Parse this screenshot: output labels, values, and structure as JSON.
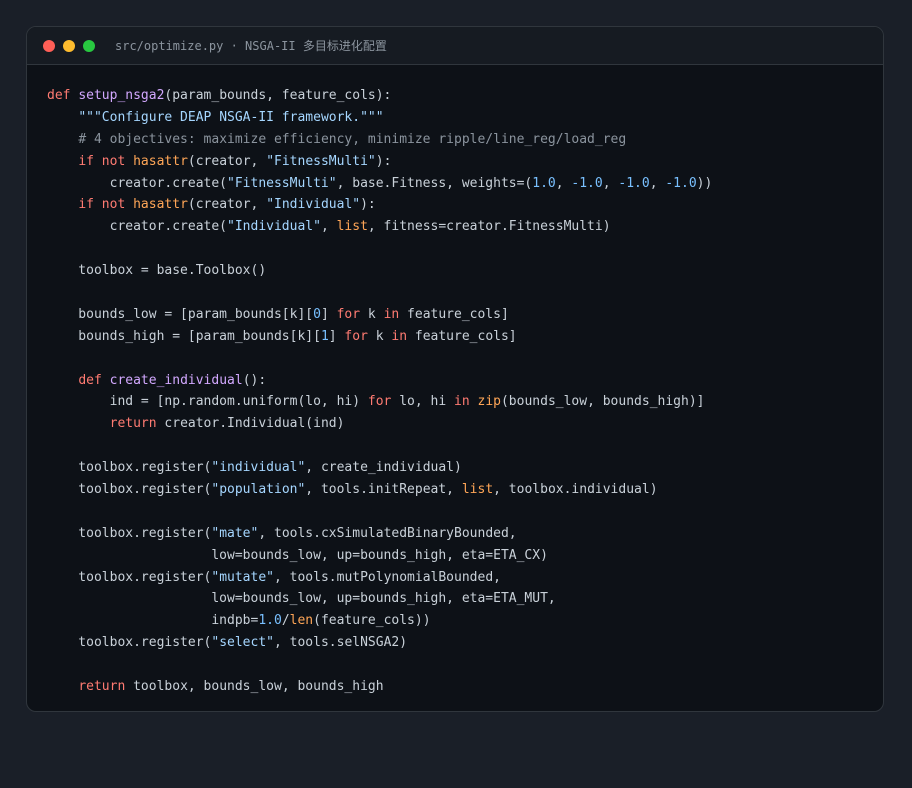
{
  "window": {
    "title": "src/optimize.py · NSGA-II 多目标进化配置"
  },
  "code": {
    "lines": [
      [
        {
          "t": "def",
          "c": "kw"
        },
        {
          "t": " "
        },
        {
          "t": "setup_nsga2",
          "c": "fn"
        },
        {
          "t": "(param_bounds, feature_cols):"
        }
      ],
      [
        {
          "t": "    "
        },
        {
          "t": "\"\"\"Configure DEAP NSGA-II framework.\"\"\"",
          "c": "doc"
        }
      ],
      [
        {
          "t": "    "
        },
        {
          "t": "# 4 objectives: maximize efficiency, minimize ripple/line_reg/load_reg",
          "c": "com"
        }
      ],
      [
        {
          "t": "    "
        },
        {
          "t": "if",
          "c": "kw"
        },
        {
          "t": " "
        },
        {
          "t": "not",
          "c": "kw"
        },
        {
          "t": " "
        },
        {
          "t": "hasattr",
          "c": "bi"
        },
        {
          "t": "(creator, "
        },
        {
          "t": "\"FitnessMulti\"",
          "c": "str"
        },
        {
          "t": "):"
        }
      ],
      [
        {
          "t": "        creator.create("
        },
        {
          "t": "\"FitnessMulti\"",
          "c": "str"
        },
        {
          "t": ", base.Fitness, weights=("
        },
        {
          "t": "1.0",
          "c": "num"
        },
        {
          "t": ", "
        },
        {
          "t": "-1.0",
          "c": "num"
        },
        {
          "t": ", "
        },
        {
          "t": "-1.0",
          "c": "num"
        },
        {
          "t": ", "
        },
        {
          "t": "-1.0",
          "c": "num"
        },
        {
          "t": "))"
        }
      ],
      [
        {
          "t": "    "
        },
        {
          "t": "if",
          "c": "kw"
        },
        {
          "t": " "
        },
        {
          "t": "not",
          "c": "kw"
        },
        {
          "t": " "
        },
        {
          "t": "hasattr",
          "c": "bi"
        },
        {
          "t": "(creator, "
        },
        {
          "t": "\"Individual\"",
          "c": "str"
        },
        {
          "t": "):"
        }
      ],
      [
        {
          "t": "        creator.create("
        },
        {
          "t": "\"Individual\"",
          "c": "str"
        },
        {
          "t": ", "
        },
        {
          "t": "list",
          "c": "bi"
        },
        {
          "t": ", fitness=creator.FitnessMulti)"
        }
      ],
      [],
      [
        {
          "t": "    toolbox = base.Toolbox()"
        }
      ],
      [],
      [
        {
          "t": "    bounds_low = [param_bounds[k]["
        },
        {
          "t": "0",
          "c": "num"
        },
        {
          "t": "] "
        },
        {
          "t": "for",
          "c": "kw"
        },
        {
          "t": " k "
        },
        {
          "t": "in",
          "c": "kw"
        },
        {
          "t": " feature_cols]"
        }
      ],
      [
        {
          "t": "    bounds_high = [param_bounds[k]["
        },
        {
          "t": "1",
          "c": "num"
        },
        {
          "t": "] "
        },
        {
          "t": "for",
          "c": "kw"
        },
        {
          "t": " k "
        },
        {
          "t": "in",
          "c": "kw"
        },
        {
          "t": " feature_cols]"
        }
      ],
      [],
      [
        {
          "t": "    "
        },
        {
          "t": "def",
          "c": "kw"
        },
        {
          "t": " "
        },
        {
          "t": "create_individual",
          "c": "fn"
        },
        {
          "t": "():"
        }
      ],
      [
        {
          "t": "        ind = [np.random.uniform(lo, hi) "
        },
        {
          "t": "for",
          "c": "kw"
        },
        {
          "t": " lo, hi "
        },
        {
          "t": "in",
          "c": "kw"
        },
        {
          "t": " "
        },
        {
          "t": "zip",
          "c": "bi"
        },
        {
          "t": "(bounds_low, bounds_high)]"
        }
      ],
      [
        {
          "t": "        "
        },
        {
          "t": "return",
          "c": "kw"
        },
        {
          "t": " creator.Individual(ind)"
        }
      ],
      [],
      [
        {
          "t": "    toolbox.register("
        },
        {
          "t": "\"individual\"",
          "c": "str"
        },
        {
          "t": ", create_individual)"
        }
      ],
      [
        {
          "t": "    toolbox.register("
        },
        {
          "t": "\"population\"",
          "c": "str"
        },
        {
          "t": ", tools.initRepeat, "
        },
        {
          "t": "list",
          "c": "bi"
        },
        {
          "t": ", toolbox.individual)"
        }
      ],
      [],
      [
        {
          "t": "    toolbox.register("
        },
        {
          "t": "\"mate\"",
          "c": "str"
        },
        {
          "t": ", tools.cxSimulatedBinaryBounded,"
        }
      ],
      [
        {
          "t": "                     low=bounds_low, up=bounds_high, eta=ETA_CX)"
        }
      ],
      [
        {
          "t": "    toolbox.register("
        },
        {
          "t": "\"mutate\"",
          "c": "str"
        },
        {
          "t": ", tools.mutPolynomialBounded,"
        }
      ],
      [
        {
          "t": "                     low=bounds_low, up=bounds_high, eta=ETA_MUT,"
        }
      ],
      [
        {
          "t": "                     indpb="
        },
        {
          "t": "1.0",
          "c": "num"
        },
        {
          "t": "/"
        },
        {
          "t": "len",
          "c": "bi"
        },
        {
          "t": "(feature_cols))"
        }
      ],
      [
        {
          "t": "    toolbox.register("
        },
        {
          "t": "\"select\"",
          "c": "str"
        },
        {
          "t": ", tools.selNSGA2)"
        }
      ],
      [],
      [
        {
          "t": "    "
        },
        {
          "t": "return",
          "c": "kw"
        },
        {
          "t": " toolbox, bounds_low, bounds_high"
        }
      ]
    ]
  }
}
